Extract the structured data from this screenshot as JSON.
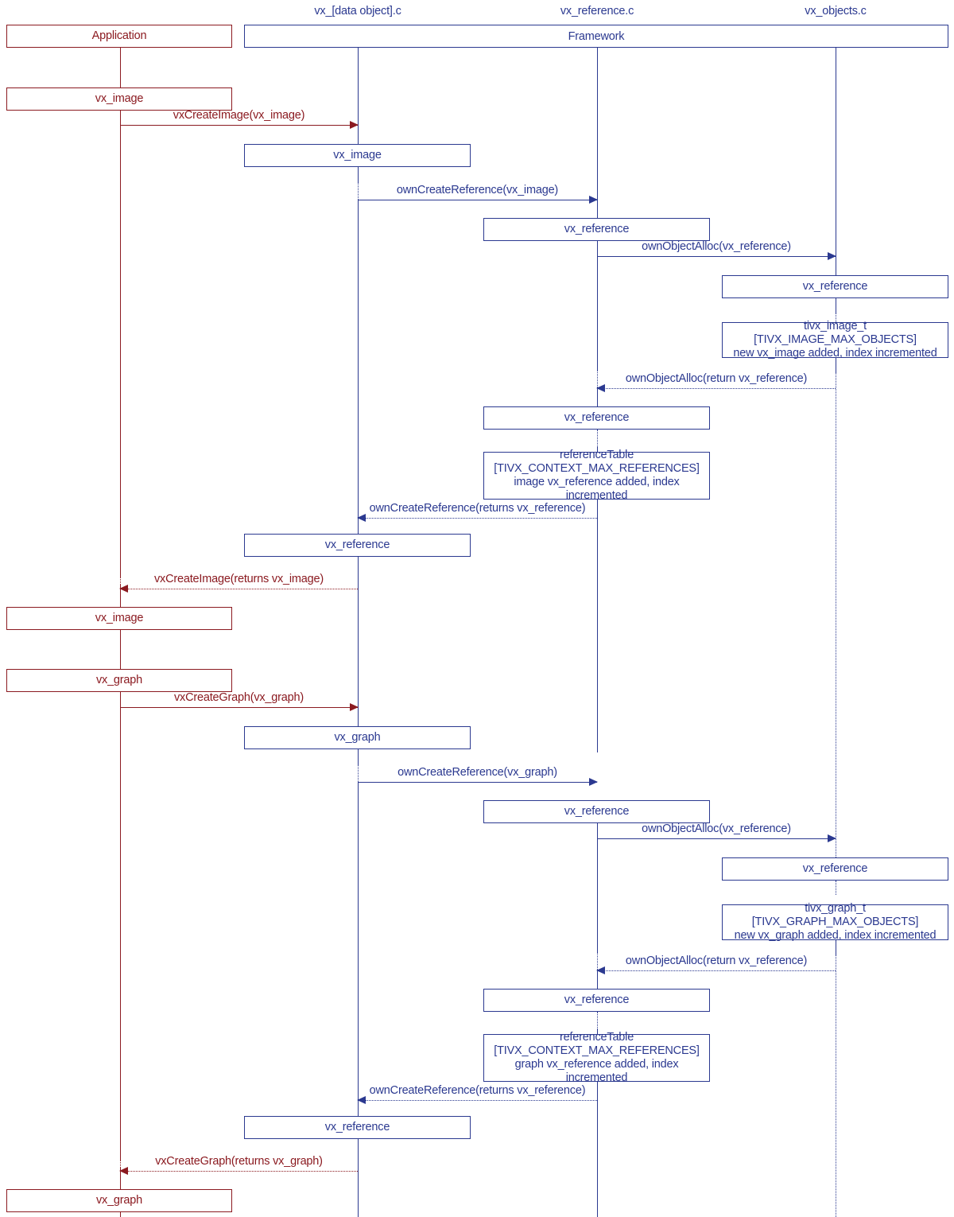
{
  "diagram": {
    "title": "OpenVX framework object creation sequence",
    "colors": {
      "application": "#8b1a20",
      "framework": "#2b3990",
      "background": "#ffffff"
    }
  },
  "lifelines": [
    {
      "id": "application",
      "label": "Application",
      "color": "#8b1a20"
    },
    {
      "id": "data_object",
      "label": "vx_[data object].c",
      "color": "#2b3990"
    },
    {
      "id": "vx_reference",
      "label": "vx_reference.c",
      "color": "#2b3990"
    },
    {
      "id": "vx_objects",
      "label": "vx_objects.c",
      "color": "#2b3990"
    }
  ],
  "framework": {
    "label": "Framework"
  },
  "boxes": {
    "app_header": "Application",
    "app_vx_image_1": "vx_image",
    "app_vx_image_2": "vx_image",
    "app_vx_graph_1": "vx_graph",
    "app_vx_graph_2": "vx_graph",
    "data_vx_image": "vx_image",
    "data_vx_reference_1": "vx_reference",
    "data_vx_graph": "vx_graph",
    "data_vx_reference_2": "vx_reference",
    "ref_vx_reference_1": "vx_reference",
    "ref_vx_reference_2": "vx_reference",
    "ref_vx_reference_3": "vx_reference",
    "ref_vx_reference_4": "vx_reference",
    "obj_vx_reference_1": "vx_reference",
    "obj_vx_reference_2": "vx_reference"
  },
  "notes": {
    "tivx_image_t": {
      "line1": "tivx_image_t",
      "line2": "[TIVX_IMAGE_MAX_OBJECTS]",
      "line3": "new vx_image added, index incremented"
    },
    "reference_table_image": {
      "line1": "referenceTable",
      "line2": "[TIVX_CONTEXT_MAX_REFERENCES]",
      "line3": "image vx_reference added, index",
      "line4": "incremented"
    },
    "tivx_graph_t": {
      "line1": "tivx_graph_t",
      "line2": "[TIVX_GRAPH_MAX_OBJECTS]",
      "line3": "new vx_graph added, index incremented"
    },
    "reference_table_graph": {
      "line1": "referenceTable",
      "line2": "[TIVX_CONTEXT_MAX_REFERENCES]",
      "line3": "graph vx_reference added, index",
      "line4": "incremented"
    }
  },
  "messages": {
    "create_image": "vxCreateImage(vx_image)",
    "own_create_reference_image": "ownCreateReference(vx_image)",
    "own_object_alloc_image": "ownObjectAlloc(vx_reference)",
    "own_object_alloc_return_image": "ownObjectAlloc(return vx_reference)",
    "own_create_reference_return_image": "ownCreateReference(returns vx_reference)",
    "create_image_return": "vxCreateImage(returns vx_image)",
    "create_graph": "vxCreateGraph(vx_graph)",
    "own_create_reference_graph": "ownCreateReference(vx_graph)",
    "own_object_alloc_graph": "ownObjectAlloc(vx_reference)",
    "own_object_alloc_return_graph": "ownObjectAlloc(return vx_reference)",
    "own_create_reference_return_graph": "ownCreateReference(returns vx_reference)",
    "create_graph_return": "vxCreateGraph(returns vx_graph)"
  }
}
